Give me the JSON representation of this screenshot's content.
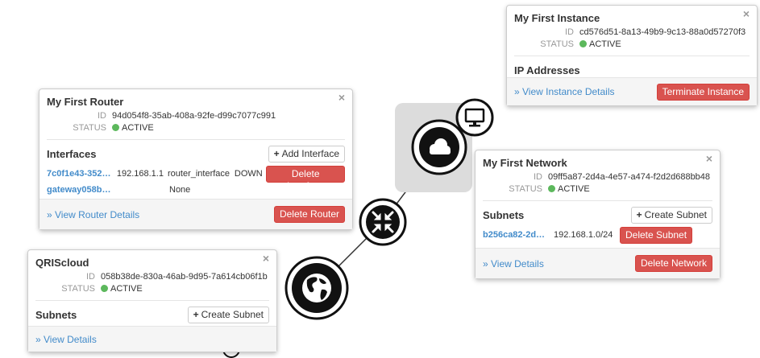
{
  "colors": {
    "accent": "#428bca",
    "danger": "#d9534f",
    "active": "#5cb85c"
  },
  "router": {
    "title": "My First Router",
    "id_label": "ID",
    "id": "94d054f8-35ab-408a-92fe-d99c7077c991",
    "status_label": "STATUS",
    "status": "ACTIVE",
    "interfaces_title": "Interfaces",
    "add_interface": "Add Interface",
    "interfaces": [
      {
        "id": "7c0f1e43-352…",
        "ip": "192.168.1.1",
        "type": "router_interface",
        "state": "DOWN",
        "delete": "Delete Interface"
      },
      {
        "id": "gateway058b…",
        "ip": "None"
      }
    ],
    "view_details": "» View Router Details",
    "delete": "Delete Router"
  },
  "instance": {
    "title": "My First Instance",
    "id_label": "ID",
    "id": "cd576d51-8a13-49b9-9c13-88a0d57270f3",
    "status_label": "STATUS",
    "status": "ACTIVE",
    "ip_title": "IP Addresses",
    "view_details": "» View Instance Details",
    "terminate": "Terminate Instance"
  },
  "network": {
    "title": "My First Network",
    "id_label": "ID",
    "id": "09ff5a87-2d4a-4e57-a474-f2d2d688bb48",
    "status_label": "STATUS",
    "status": "ACTIVE",
    "subnets_title": "Subnets",
    "create_subnet": "Create Subnet",
    "subnets": [
      {
        "id": "b256ca82-2d…",
        "cidr": "192.168.1.0/24",
        "delete": "Delete Subnet"
      }
    ],
    "view_details": "» View Details",
    "delete": "Delete Network"
  },
  "external": {
    "title": "QRIScloud",
    "id_label": "ID",
    "id": "058b38de-830a-46ab-9d95-7a614cb06f1b",
    "status_label": "STATUS",
    "status": "ACTIVE",
    "subnets_title": "Subnets",
    "create_subnet": "Create Subnet",
    "view_details": "» View Details"
  },
  "close_glyph": "×",
  "plus_glyph": "+"
}
